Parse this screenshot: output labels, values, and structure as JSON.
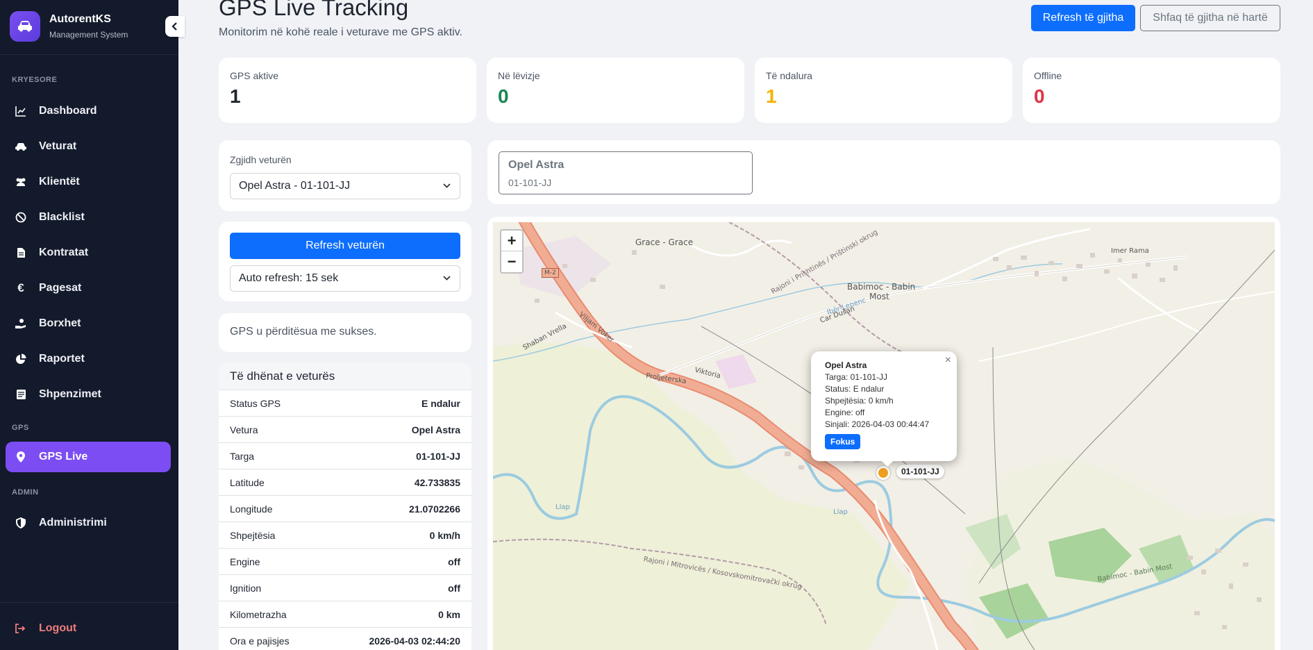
{
  "app": {
    "name": "AutorentKS",
    "subtitle": "Management System"
  },
  "sidebar": {
    "section_main": "KRYESORE",
    "section_gps": "GPS",
    "section_admin": "ADMIN",
    "items": [
      {
        "label": "Dashboard",
        "icon": "chart-line-icon"
      },
      {
        "label": "Veturat",
        "icon": "car-icon"
      },
      {
        "label": "Klientët",
        "icon": "users-icon"
      },
      {
        "label": "Blacklist",
        "icon": "ban-icon"
      },
      {
        "label": "Kontratat",
        "icon": "file-icon"
      },
      {
        "label": "Pagesat",
        "icon": "euro-icon"
      },
      {
        "label": "Borxhet",
        "icon": "hand-coin-icon"
      },
      {
        "label": "Raportet",
        "icon": "pie-chart-icon"
      },
      {
        "label": "Shpenzimet",
        "icon": "receipt-icon"
      }
    ],
    "gps_item": {
      "label": "GPS Live",
      "icon": "map-pin-icon"
    },
    "admin_item": {
      "label": "Administrimi",
      "icon": "shield-icon"
    },
    "logout": "Logout"
  },
  "header": {
    "title": "GPS Live Tracking",
    "subtitle": "Monitorim në kohë reale i veturave me GPS aktiv.",
    "refresh_all": "Refresh të gjitha",
    "show_all": "Shfaq të gjitha në hartë"
  },
  "stats": [
    {
      "label": "GPS aktive",
      "value": "1",
      "color": "#1f2530"
    },
    {
      "label": "Në lëvizje",
      "value": "0",
      "color": "#198754"
    },
    {
      "label": "Të ndalura",
      "value": "1",
      "color": "#f0b400"
    },
    {
      "label": "Offline",
      "value": "0",
      "color": "#dc3545"
    }
  ],
  "vehicle_select": {
    "label": "Zgjidh veturën",
    "value": "Opel Astra - 01-101-JJ"
  },
  "refresh_vehicle": "Refresh veturën",
  "auto_refresh": "Auto refresh: 15 sek",
  "status_message": "GPS u përditësua me sukses.",
  "details": {
    "title": "Të dhënat e veturës",
    "rows": [
      {
        "k": "Status GPS",
        "v": "E ndalur"
      },
      {
        "k": "Vetura",
        "v": "Opel Astra"
      },
      {
        "k": "Targa",
        "v": "01-101-JJ"
      },
      {
        "k": "Latitude",
        "v": "42.733835"
      },
      {
        "k": "Longitude",
        "v": "21.0702266"
      },
      {
        "k": "Shpejtësia",
        "v": "0 km/h"
      },
      {
        "k": "Engine",
        "v": "off"
      },
      {
        "k": "Ignition",
        "v": "off"
      },
      {
        "k": "Kilometrazha",
        "v": "0 km"
      },
      {
        "k": "Ora e pajisjes",
        "v": "2026-04-03 02:44:20"
      }
    ]
  },
  "vehicle_chip": {
    "name": "Opel Astra",
    "plate": "01-101-JJ"
  },
  "map": {
    "zoom_in": "+",
    "zoom_out": "−",
    "popup": {
      "title": "Opel Astra",
      "lines": [
        "Targa: 01-101-JJ",
        "Status: E ndalur",
        "Shpejtësia: 0 km/h",
        "Engine: off",
        "Sinjali: 2026-04-03 00:44:47"
      ],
      "button": "Fokus",
      "close": "×"
    },
    "marker_label": "01-101-JJ",
    "labels": {
      "grace": "Grace - Grace",
      "babimoc": "Babimoc - Babin",
      "most": "Most",
      "vilijam": "Viljam Voker",
      "viktoria": "Viktoria",
      "m2": "M-2",
      "proljeterska": "Proljeterska",
      "car_dusan": "Car Dušan",
      "iber": "Ibër-Lepenc",
      "llap": "Llap",
      "rajoni_mitrovices": "Rajoni i Mitrovicës / Kosovskomitrovački okrug",
      "rajoni_prishtines": "Rajoni i Prishtinës / Prištinski okrug",
      "babimoc2": "Babimoc - Babin Most",
      "imer_rama": "Imer Rama",
      "shaban": "Shaban Vrella"
    }
  }
}
